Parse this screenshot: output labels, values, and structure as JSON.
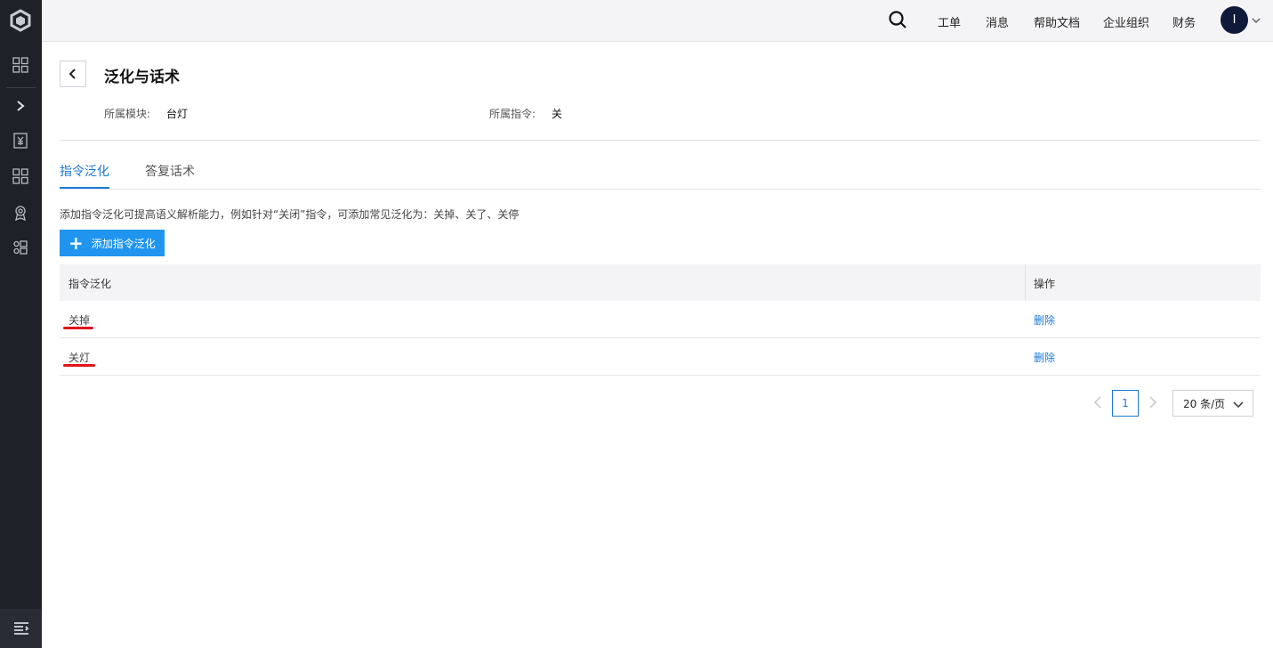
{
  "topbar": {
    "links": [
      "工单",
      "消息",
      "帮助文档",
      "企业组织",
      "财务"
    ],
    "avatar_letter": "I"
  },
  "sidebar": {
    "icons": [
      "grid-icon",
      "chevron-right-icon",
      "yuan-receipt-icon",
      "apps-grid-icon",
      "badge-icon",
      "modules-icon"
    ],
    "bottom_icon": "menu-collapse-icon"
  },
  "page": {
    "title": "泛化与话术",
    "module_label": "所属模块:",
    "module_value": "台灯",
    "command_label": "所属指令:",
    "command_value": "关"
  },
  "tabs": [
    {
      "label": "指令泛化",
      "active": true
    },
    {
      "label": "答复话术",
      "active": false
    }
  ],
  "hint": "添加指令泛化可提高语义解析能力，例如针对“关闭”指令，可添加常见泛化为：关掉、关了、关停",
  "add_button": "添加指令泛化",
  "table": {
    "headers": [
      "指令泛化",
      "操作"
    ],
    "rows": [
      {
        "text": "关掉",
        "action": "删除"
      },
      {
        "text": "关灯",
        "action": "删除"
      }
    ]
  },
  "pagination": {
    "current_page": "1",
    "page_size": "20 条/页"
  },
  "colors": {
    "accent": "#1a79d8",
    "button": "#1f95f0",
    "sidebar": "#1f2129",
    "annotation": "#e3141c"
  }
}
